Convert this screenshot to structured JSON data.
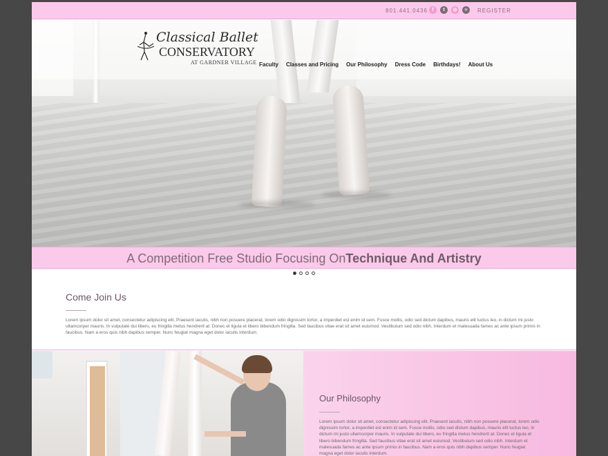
{
  "topbar": {
    "phone": "801.441.0436",
    "social": [
      {
        "icon": "facebook-icon",
        "glyph": "f"
      },
      {
        "icon": "twitter-icon",
        "glyph": "t"
      },
      {
        "icon": "instagram-icon",
        "glyph": "◎"
      },
      {
        "icon": "rss-icon",
        "glyph": "≈"
      }
    ],
    "register": "REGISTER"
  },
  "logo": {
    "line1": "Classical Ballet",
    "line2": "CONSERVATORY",
    "line3": "AT GARDNER VILLAGE"
  },
  "nav": [
    "Faculty",
    "Classes and Pricing",
    "Our Philosophy",
    "Dress Code",
    "Birthdays!",
    "About Us"
  ],
  "tagline": {
    "normal": "A Competition Free Studio Focusing On ",
    "bold": "Technique And Artistry"
  },
  "slider": {
    "count": 4,
    "active": 0
  },
  "join": {
    "title": "Come Join Us",
    "text": "Lorem ipsum dolor sit amet, consectetur adipiscing elit. Praesent iaculis, nibh non posuere placerat, lorem odio dignissim tortor, a imperdiet est enim id sem. Fusce mollis, odio sed dictum dapibus, mauris elit luctus leo, in dictum mi justo ullamcorper mauris. In vulputate dui libero, eu fringilla metus hendrerit at. Donec et ligula et libero bibendum fringilla. Sed faucibus vitae erat sit amet euismod. Vestibulum sed odio nibh. Interdum et malesuada fames ac ante ipsum primis in faucibus. Nam a eros quis nibh dapibus semper. Nunc feugiat magna eget dolor iaculis interdum."
  },
  "philosophy": {
    "title": "Our Philosophy",
    "text": "Lorem ipsum dolor sit amet, consectetur adipiscing elit. Praesent iaculis, nibh non posuere placerat, lorem odio dignissim tortor, a imperdiet est enim id sem. Fusce mollis, odio sed dictum dapibus, mauris elit luctus leo, in dictum mi justo ullamcorper mauris. In vulputate dui libero, eu fringilla metus hendrerit at. Donec et ligula et libero bibendum fringilla. Sed faucibus vitae erat sit amet euismod. Vestibulum sed odio nibh. Interdum et malesuada fames ac ante ipsum primis in faucibus. Nam a eros quis nibh dapibus semper. Nunc feugiat magna eget dolor iaculis interdum."
  },
  "colors": {
    "brand_pink": "#fbc9ea",
    "text_mauve": "#6b5563",
    "backdrop": "#474747"
  }
}
